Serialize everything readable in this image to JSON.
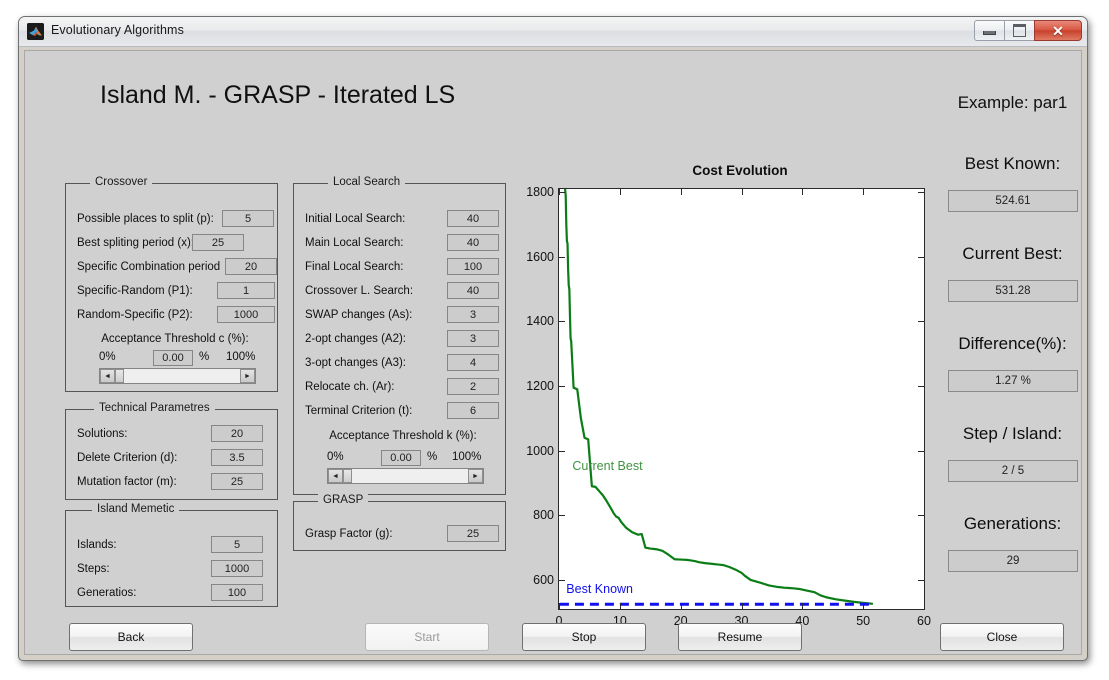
{
  "window": {
    "title": "Evolutionary Algorithms",
    "icon": "matlab-icon",
    "minimize_label": "",
    "maximize_label": "",
    "close_label": "✕"
  },
  "header": {
    "app_title": "Island M. - GRASP - Iterated LS",
    "example_label": "Example: par1"
  },
  "crossover": {
    "panel_title": "Crossover",
    "fields": [
      {
        "label": "Possible places to split (p):",
        "value": "5"
      },
      {
        "label": "Best spliting period (x):",
        "value": "25"
      },
      {
        "label": "Specific Combination period",
        "value": "20"
      },
      {
        "label": "Specific-Random (P1):",
        "value": "1"
      },
      {
        "label": "Random-Specific (P2):",
        "value": "1000"
      }
    ],
    "slider": {
      "caption": "Acceptance Threshold c (%):",
      "min_label": "0%",
      "max_label": "100%",
      "value": "0.00",
      "unit": "%",
      "left_arrow": "◄",
      "right_arrow": "►"
    }
  },
  "technical": {
    "panel_title": "Technical Parametres",
    "fields": [
      {
        "label": "Solutions:",
        "value": "20"
      },
      {
        "label": "Delete Criterion (d):",
        "value": "3.5"
      },
      {
        "label": "Mutation factor (m):",
        "value": "25"
      }
    ]
  },
  "island": {
    "panel_title": "Island Memetic",
    "fields": [
      {
        "label": "Islands:",
        "value": "5"
      },
      {
        "label": "Steps:",
        "value": "1000"
      },
      {
        "label": "Generatios:",
        "value": "100"
      }
    ]
  },
  "local_search": {
    "panel_title": "Local Search",
    "fields": [
      {
        "label": "Initial Local Search:",
        "value": "40"
      },
      {
        "label": "Main Local Search:",
        "value": "40"
      },
      {
        "label": "Final Local Search:",
        "value": "100"
      },
      {
        "label": "Crossover L. Search:",
        "value": "40"
      },
      {
        "label": "SWAP changes (As):",
        "value": "3"
      },
      {
        "label": "2-opt changes (A2):",
        "value": "3"
      },
      {
        "label": "3-opt changes (A3):",
        "value": "4"
      },
      {
        "label": "Relocate ch. (Ar):",
        "value": "2"
      },
      {
        "label": "Terminal Criterion (t):",
        "value": "6"
      }
    ],
    "slider": {
      "caption": "Acceptance Threshold k (%):",
      "min_label": "0%",
      "max_label": "100%",
      "value": "0.00",
      "unit": "%",
      "left_arrow": "◄",
      "right_arrow": "►"
    }
  },
  "grasp": {
    "panel_title": "GRASP",
    "fields": [
      {
        "label": "Grasp Factor (g):",
        "value": "25"
      }
    ]
  },
  "status": {
    "items": [
      {
        "label": "Best Known:",
        "value": "524.61"
      },
      {
        "label": "Current Best:",
        "value": "531.28"
      },
      {
        "label": "Difference(%):",
        "value": "1.27 %"
      },
      {
        "label": "Step / Island:",
        "value": "2 / 5"
      },
      {
        "label": "Generations:",
        "value": "29"
      }
    ]
  },
  "buttons": [
    {
      "label": "Back",
      "enabled": true
    },
    {
      "label": "Start",
      "enabled": false
    },
    {
      "label": "Stop",
      "enabled": true
    },
    {
      "label": "Resume",
      "enabled": true
    },
    {
      "label": "Close",
      "enabled": true
    }
  ],
  "chart_data": {
    "type": "line",
    "title": "Cost Evolution",
    "xlabel": "",
    "ylabel": "",
    "xlim": [
      0,
      60
    ],
    "ylim": [
      510,
      1810
    ],
    "xticks": [
      0,
      10,
      20,
      30,
      40,
      50,
      60
    ],
    "yticks": [
      600,
      800,
      1000,
      1200,
      1400,
      1600,
      1800
    ],
    "grid": false,
    "legend_position": "inline-annotations",
    "series": [
      {
        "name": "Current Best",
        "color": "#0a7d16",
        "style": "solid",
        "label_color": "#3f9440",
        "x": [
          1.0,
          1.1,
          1.2,
          1.3,
          1.4,
          1.5,
          1.6,
          1.7,
          1.8,
          1.9,
          2.0,
          2.4,
          3.0,
          3.6,
          4.2,
          4.8,
          5.4,
          6.0,
          6.6,
          7.2,
          7.8,
          8.4,
          9.0,
          9.4,
          9.8,
          10.2,
          11.0,
          12.0,
          13.0,
          13.6,
          14.2,
          15.0,
          16.0,
          17.0,
          18.0,
          19.0,
          20.0,
          21.0,
          21.8,
          22.4,
          23.0,
          24.0,
          25.0,
          26.0,
          27.0,
          28.0,
          29.0,
          30.0,
          30.6,
          31.5,
          33.0,
          34.5,
          36.0,
          37.0,
          37.8,
          38.5,
          39.5,
          41.0,
          42.0,
          43.0,
          44.0,
          45.5,
          47.0,
          48.5,
          50.0,
          51.0,
          51.6
        ],
        "y": [
          1810,
          1790,
          1700,
          1648,
          1642,
          1560,
          1512,
          1500,
          1420,
          1348,
          1340,
          1195,
          1190,
          1100,
          1040,
          1035,
          890,
          888,
          875,
          862,
          845,
          826,
          806,
          796,
          792,
          780,
          762,
          748,
          740,
          742,
          700,
          697,
          695,
          690,
          678,
          664,
          663,
          662,
          660,
          658,
          655,
          652,
          650,
          648,
          646,
          640,
          632,
          622,
          612,
          600,
          592,
          583,
          578,
          576,
          575,
          574,
          572,
          566,
          562,
          552,
          546,
          540,
          536,
          532,
          529,
          527,
          526
        ]
      },
      {
        "name": "Best Known",
        "color": "#1111ee",
        "style": "dashed",
        "label_color": "#1111ee",
        "value": 524.61,
        "x": [
          0.15,
          51.8
        ],
        "y": [
          524.61,
          524.61
        ]
      }
    ],
    "annotations": [
      {
        "text": "Current Best",
        "x": 2.2,
        "y": 940,
        "color": "#3f9440"
      },
      {
        "text": "Best Known",
        "x": 1.2,
        "y": 560,
        "color": "#1111ee"
      }
    ]
  }
}
